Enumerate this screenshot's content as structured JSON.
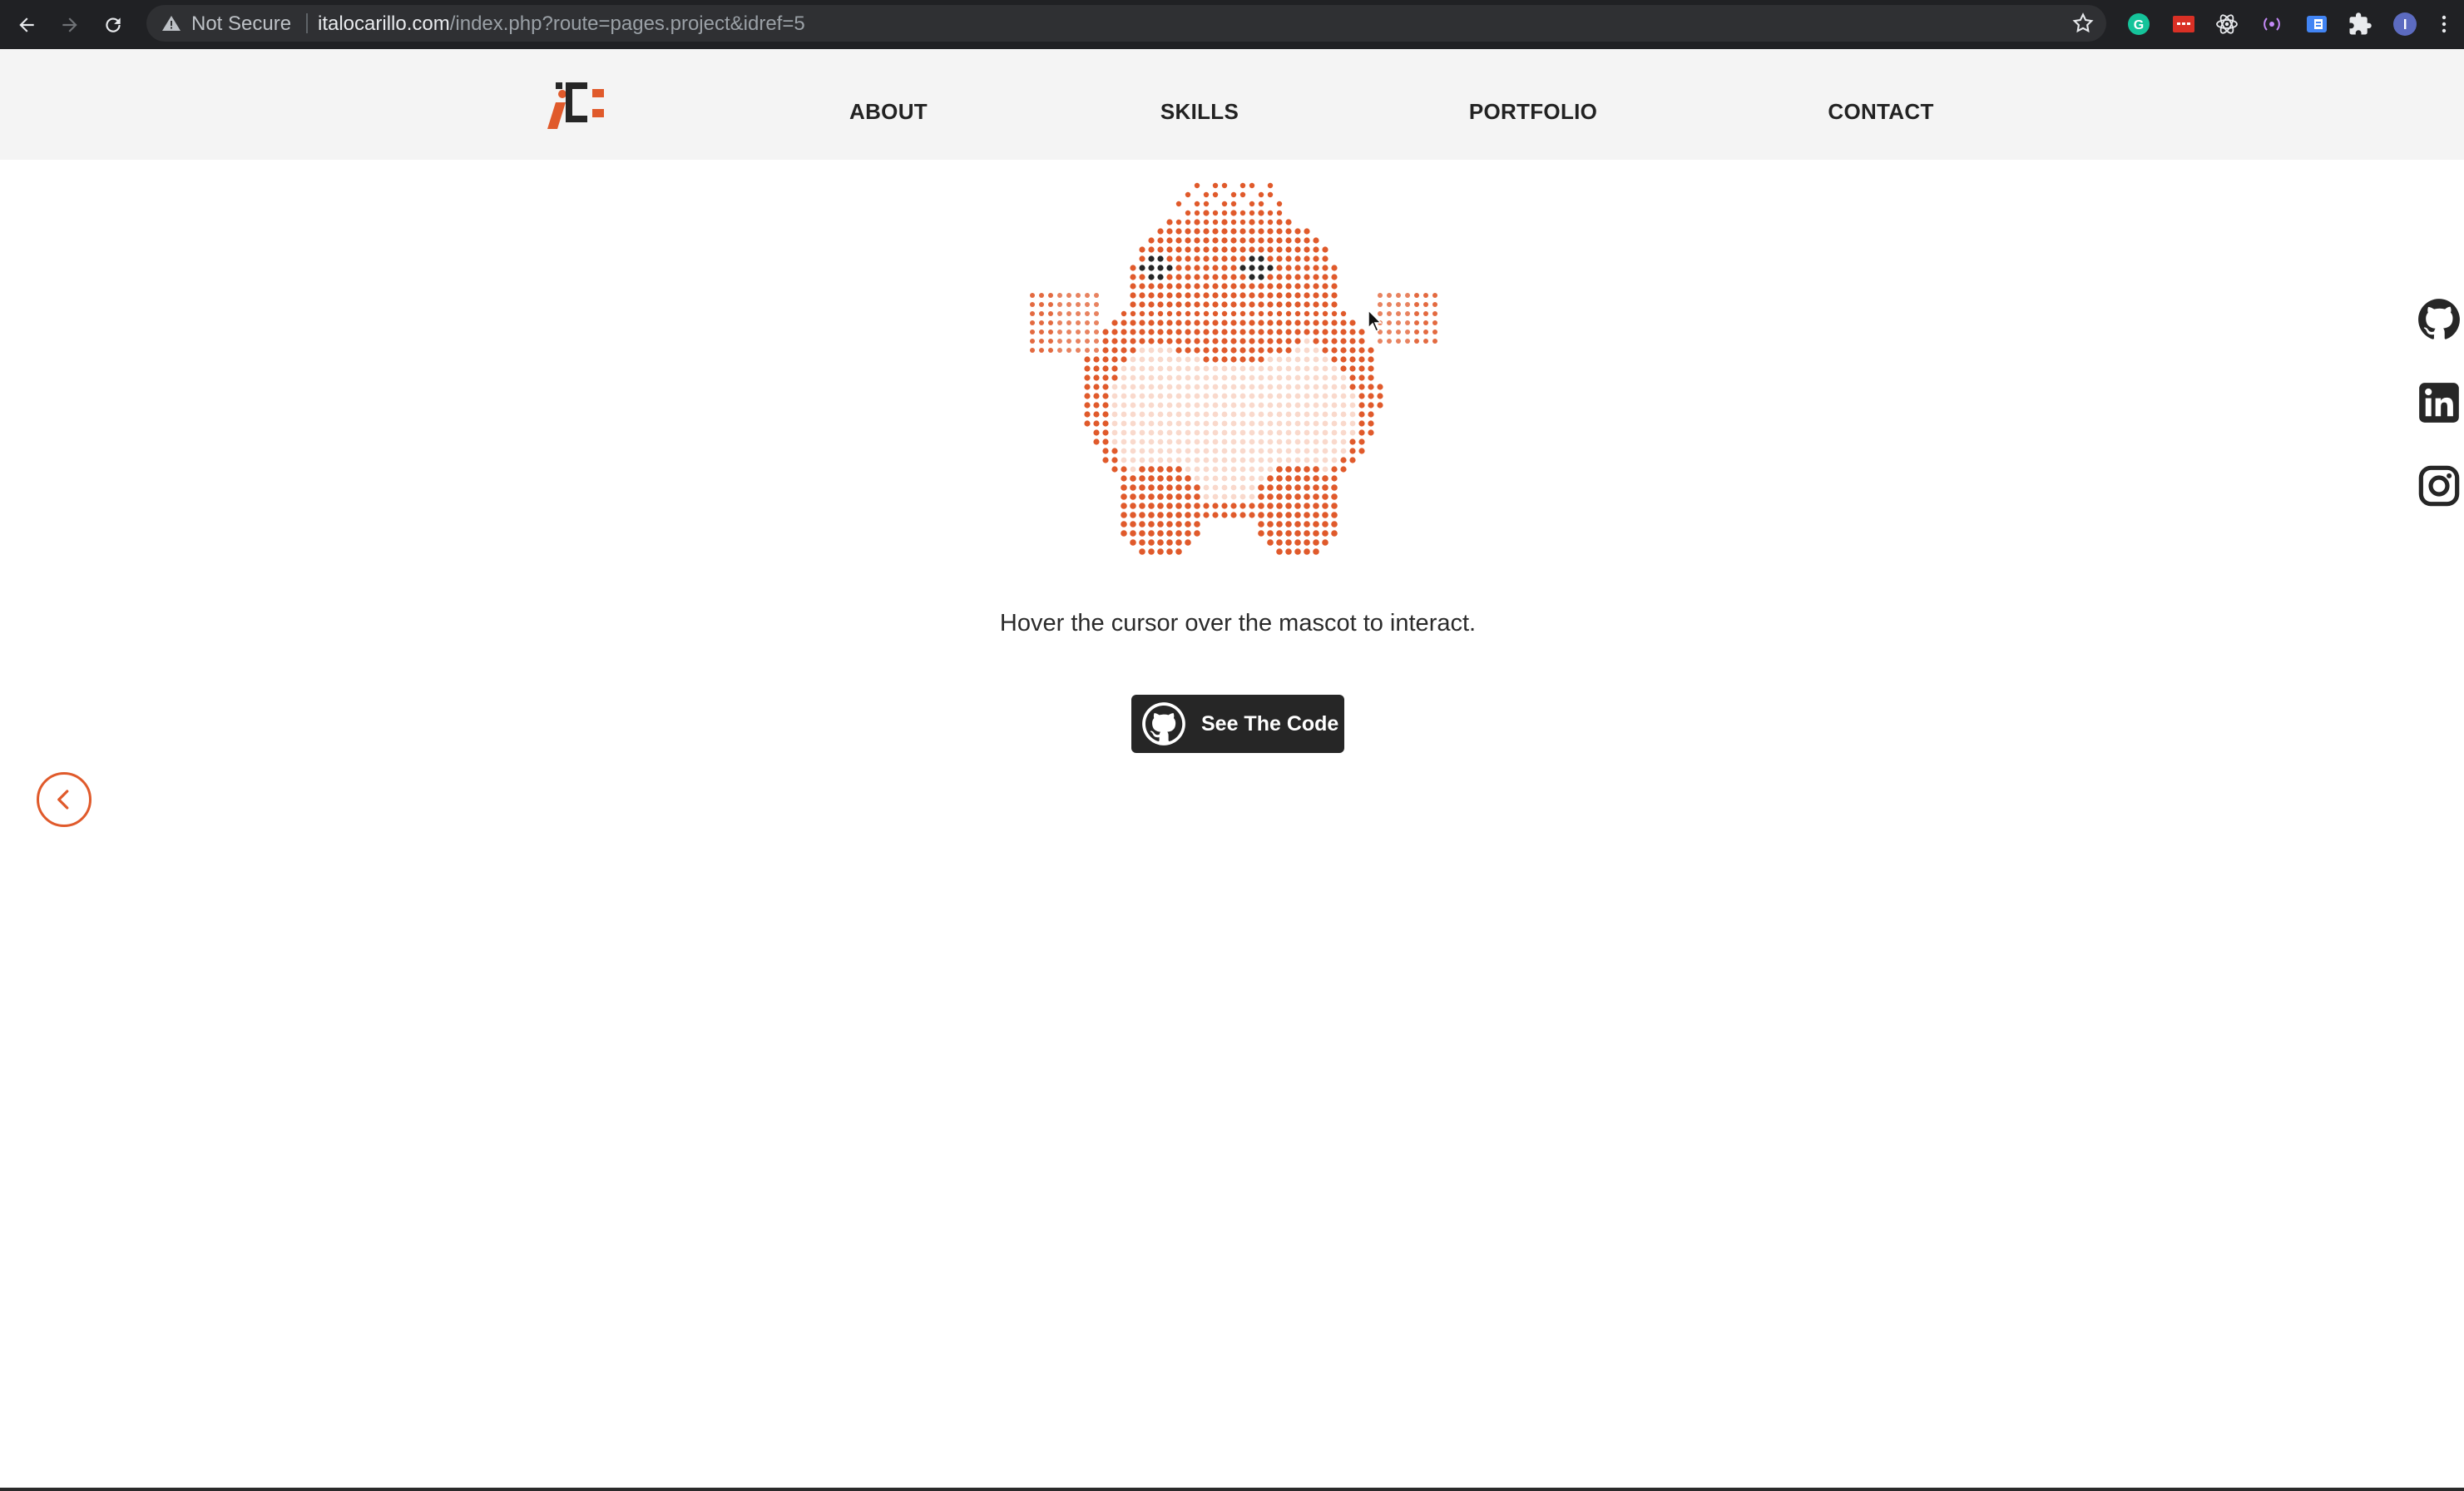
{
  "browser": {
    "security_label": "Not Secure",
    "url_host": "italocarillo.com",
    "url_path": "/index.php?route=pages.project&idref=5"
  },
  "nav": {
    "items": [
      {
        "label": "ABOUT"
      },
      {
        "label": "SKILLS"
      },
      {
        "label": "PORTFOLIO"
      },
      {
        "label": "CONTACT"
      }
    ]
  },
  "main": {
    "hint": "Hover the cursor over the mascot to interact.",
    "code_button_label": "See The Code"
  },
  "social": [
    "github-icon",
    "linkedin-icon",
    "instagram-icon"
  ],
  "colors": {
    "accent": "#e05a2b",
    "mascot_light": "#f9d9cc",
    "dark": "#262626"
  }
}
